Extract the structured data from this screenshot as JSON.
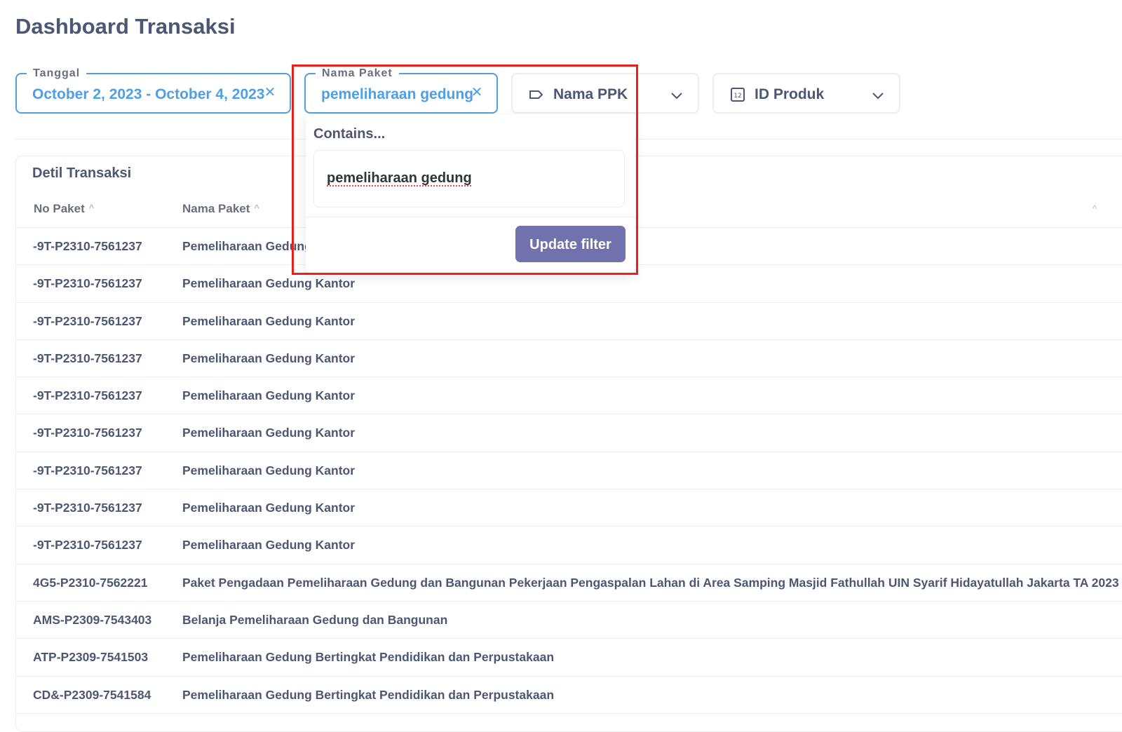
{
  "page": {
    "title": "Dashboard Transaksi"
  },
  "filters": {
    "tanggal": {
      "legend": "Tanggal",
      "value": "October 2, 2023 - October 4, 2023",
      "clear_icon": "close-icon"
    },
    "nama_paket": {
      "legend": "Nama Paket",
      "value": "pemeliharaan gedung",
      "clear_icon": "close-icon"
    },
    "nama_ppk": {
      "label": "Nama PPK",
      "icon": "tag-icon"
    },
    "id_produk": {
      "label": "ID Produk",
      "icon": "number-icon"
    }
  },
  "popover": {
    "title": "Contains...",
    "input_value": "pemeliharaan gedung",
    "button_label": "Update filter"
  },
  "table": {
    "title": "Detil Transaksi",
    "columns": [
      "No Paket",
      "Nama Paket"
    ],
    "rows": [
      [
        "-9T-P2310-7561237",
        "Pemeliharaan Gedung Kantor"
      ],
      [
        "-9T-P2310-7561237",
        "Pemeliharaan Gedung Kantor"
      ],
      [
        "-9T-P2310-7561237",
        "Pemeliharaan Gedung Kantor"
      ],
      [
        "-9T-P2310-7561237",
        "Pemeliharaan Gedung Kantor"
      ],
      [
        "-9T-P2310-7561237",
        "Pemeliharaan Gedung Kantor"
      ],
      [
        "-9T-P2310-7561237",
        "Pemeliharaan Gedung Kantor"
      ],
      [
        "-9T-P2310-7561237",
        "Pemeliharaan Gedung Kantor"
      ],
      [
        "-9T-P2310-7561237",
        "Pemeliharaan Gedung Kantor"
      ],
      [
        "-9T-P2310-7561237",
        "Pemeliharaan Gedung Kantor"
      ],
      [
        "4G5-P2310-7562221",
        "Paket Pengadaan Pemeliharaan Gedung dan Bangunan Pekerjaan Pengaspalan Lahan di Area Samping Masjid Fathullah UIN Syarif Hidayatullah Jakarta TA 2023"
      ],
      [
        "AMS-P2309-7543403",
        "Belanja Pemeliharaan Gedung dan Bangunan"
      ],
      [
        "ATP-P2309-7541503",
        "Pemeliharaan Gedung Bertingkat Pendidikan dan Perpustakaan"
      ],
      [
        "CD&-P2309-7541584",
        "Pemeliharaan Gedung Bertingkat Pendidikan dan Perpustakaan"
      ]
    ]
  },
  "colors": {
    "accent_blue": "#509ee3",
    "button_purple": "#7172ad",
    "text_dark": "#4c5773",
    "highlight_red": "#e8221b"
  }
}
